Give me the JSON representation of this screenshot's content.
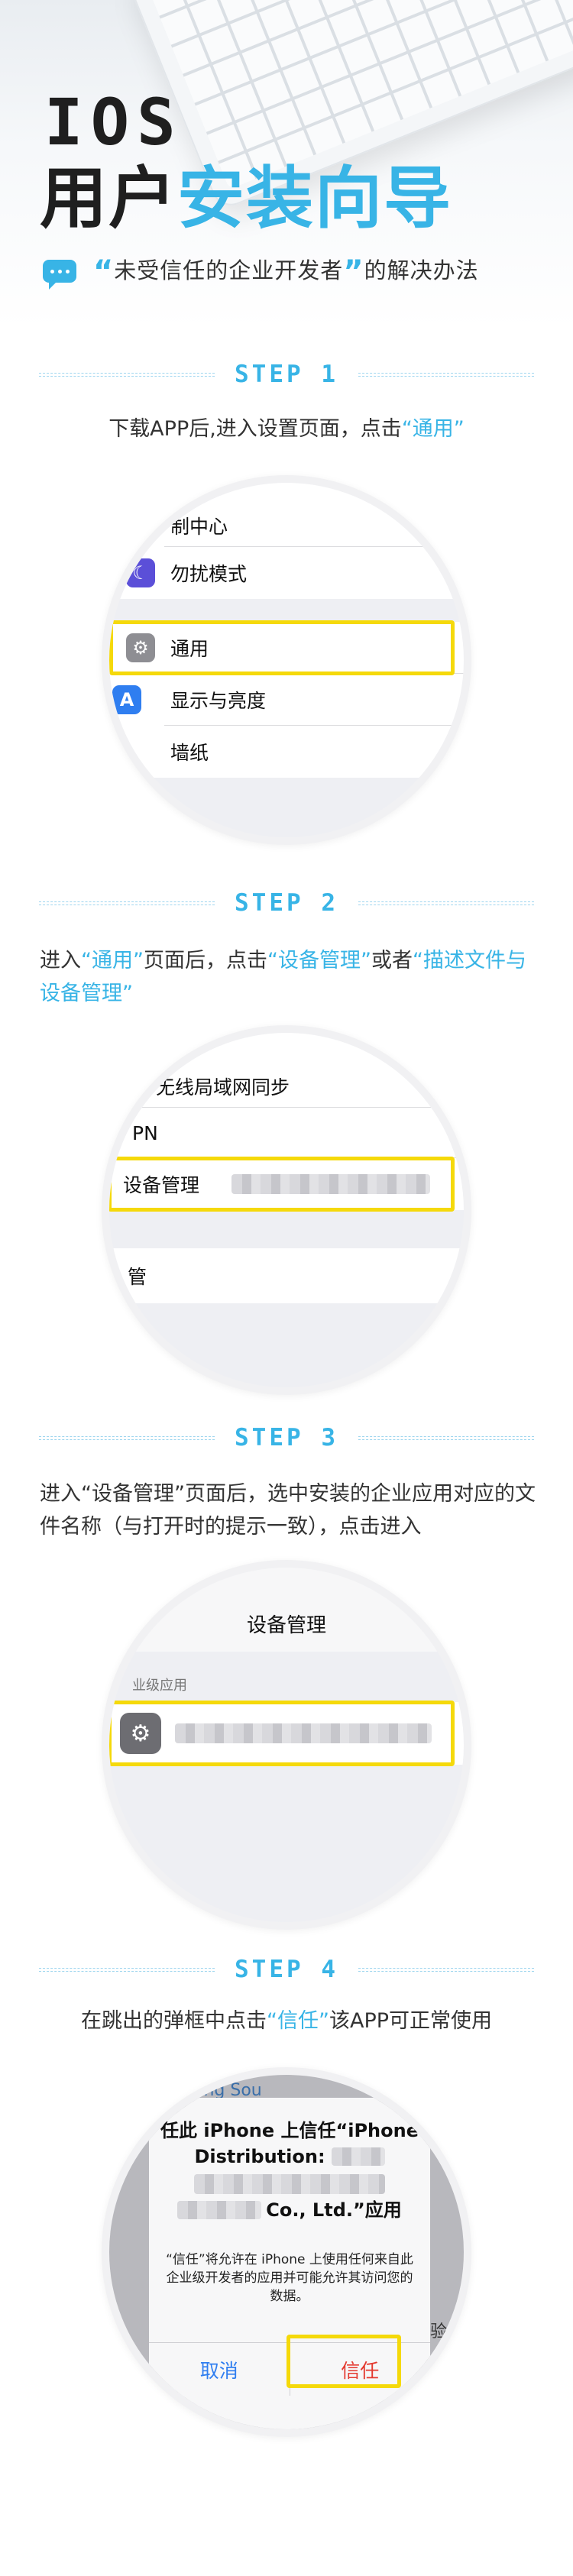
{
  "header": {
    "title_ios": "IOS",
    "title_part1": "用户",
    "title_part2": "安装向导",
    "subtitle_open": "“",
    "subtitle_quoted": "未受信任的企业开发者",
    "subtitle_close": "”",
    "subtitle_rest": "的解决办法"
  },
  "colors": {
    "accent": "#38b4e6",
    "highlight_box": "#f5d90a",
    "ios_blue": "#2f7ef0",
    "ios_red": "#e43a30"
  },
  "steps": [
    {
      "label": "STEP 1",
      "desc_parts": [
        "下载APP后,进入设置页面，点击",
        "“通用”"
      ],
      "screen": {
        "rows": [
          "制中心",
          "勿扰模式",
          "通用",
          "显示与亮度",
          "墙纸"
        ],
        "icons": [
          "moon-icon",
          "gear-icon",
          "display-icon"
        ]
      }
    },
    {
      "label": "STEP 2",
      "desc_parts": [
        "进入",
        "“通用”",
        "页面后，点击",
        "“设备管理”",
        "或者",
        "“描述文件与设备管理”"
      ],
      "screen": {
        "rows": [
          "s 无线局域网同步",
          "PN",
          "设备管理",
          "管"
        ]
      }
    },
    {
      "label": "STEP 3",
      "desc_parts": [
        "进入“设备管理”页面后，选中安装的企业应用对应的文件名称（与打开时的提示一致），点击进入"
      ],
      "screen": {
        "nav_title": "设备管理",
        "section_header": "业级应用"
      }
    },
    {
      "label": "STEP 4",
      "desc_parts": [
        "在跳出的弹框中点击",
        "“信任”",
        "该APP可正常使用"
      ],
      "screen": {
        "top_text": "ong Sou",
        "side_text": "验",
        "dialog_title_1": "任此 iPhone 上信任“iPhone",
        "dialog_title_2": "Distribution:",
        "dialog_title_3": "Co., Ltd.”应用",
        "dialog_message": "“信任”将允许在 iPhone 上使用任何来自此企业级开发者的应用并可能允许其访问您的数据。",
        "cancel_label": "取消",
        "trust_label": "信任"
      }
    }
  ]
}
